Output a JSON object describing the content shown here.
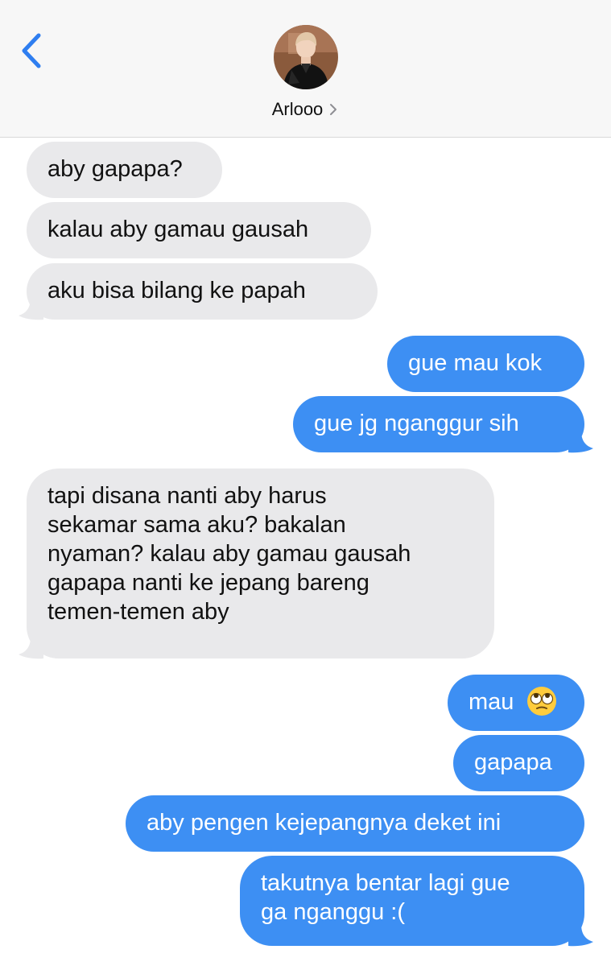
{
  "header": {
    "contact_name": "Arlooo",
    "icons": {
      "back": "chevron-left-icon",
      "avatar": "avatar-photo",
      "details": "chevron-right-icon"
    }
  },
  "colors": {
    "incoming": "#e9e9eb",
    "outgoing": "#3d8ff3",
    "accent": "#2f7ef0"
  },
  "messages": [
    {
      "direction": "incoming",
      "text": "aby gapapa?"
    },
    {
      "direction": "incoming",
      "text": "kalau aby gamau gausah"
    },
    {
      "direction": "incoming",
      "text": "aku bisa bilang ke papah"
    },
    {
      "direction": "outgoing",
      "text": "gue mau kok"
    },
    {
      "direction": "outgoing",
      "text": "gue jg nganggur sih"
    },
    {
      "direction": "incoming",
      "lines": [
        "tapi disana nanti aby harus",
        "sekamar sama aku? bakalan",
        "nyaman? kalau aby gamau gausah",
        "gapapa nanti ke jepang bareng",
        "temen-temen aby"
      ]
    },
    {
      "direction": "outgoing",
      "text": "mau",
      "emoji": "face-with-rolling-eyes"
    },
    {
      "direction": "outgoing",
      "text": "gapapa"
    },
    {
      "direction": "outgoing",
      "text": "aby pengen kejepangnya deket ini"
    },
    {
      "direction": "outgoing",
      "lines": [
        "takutnya bentar lagi gue",
        "ga nganggu :("
      ]
    }
  ]
}
